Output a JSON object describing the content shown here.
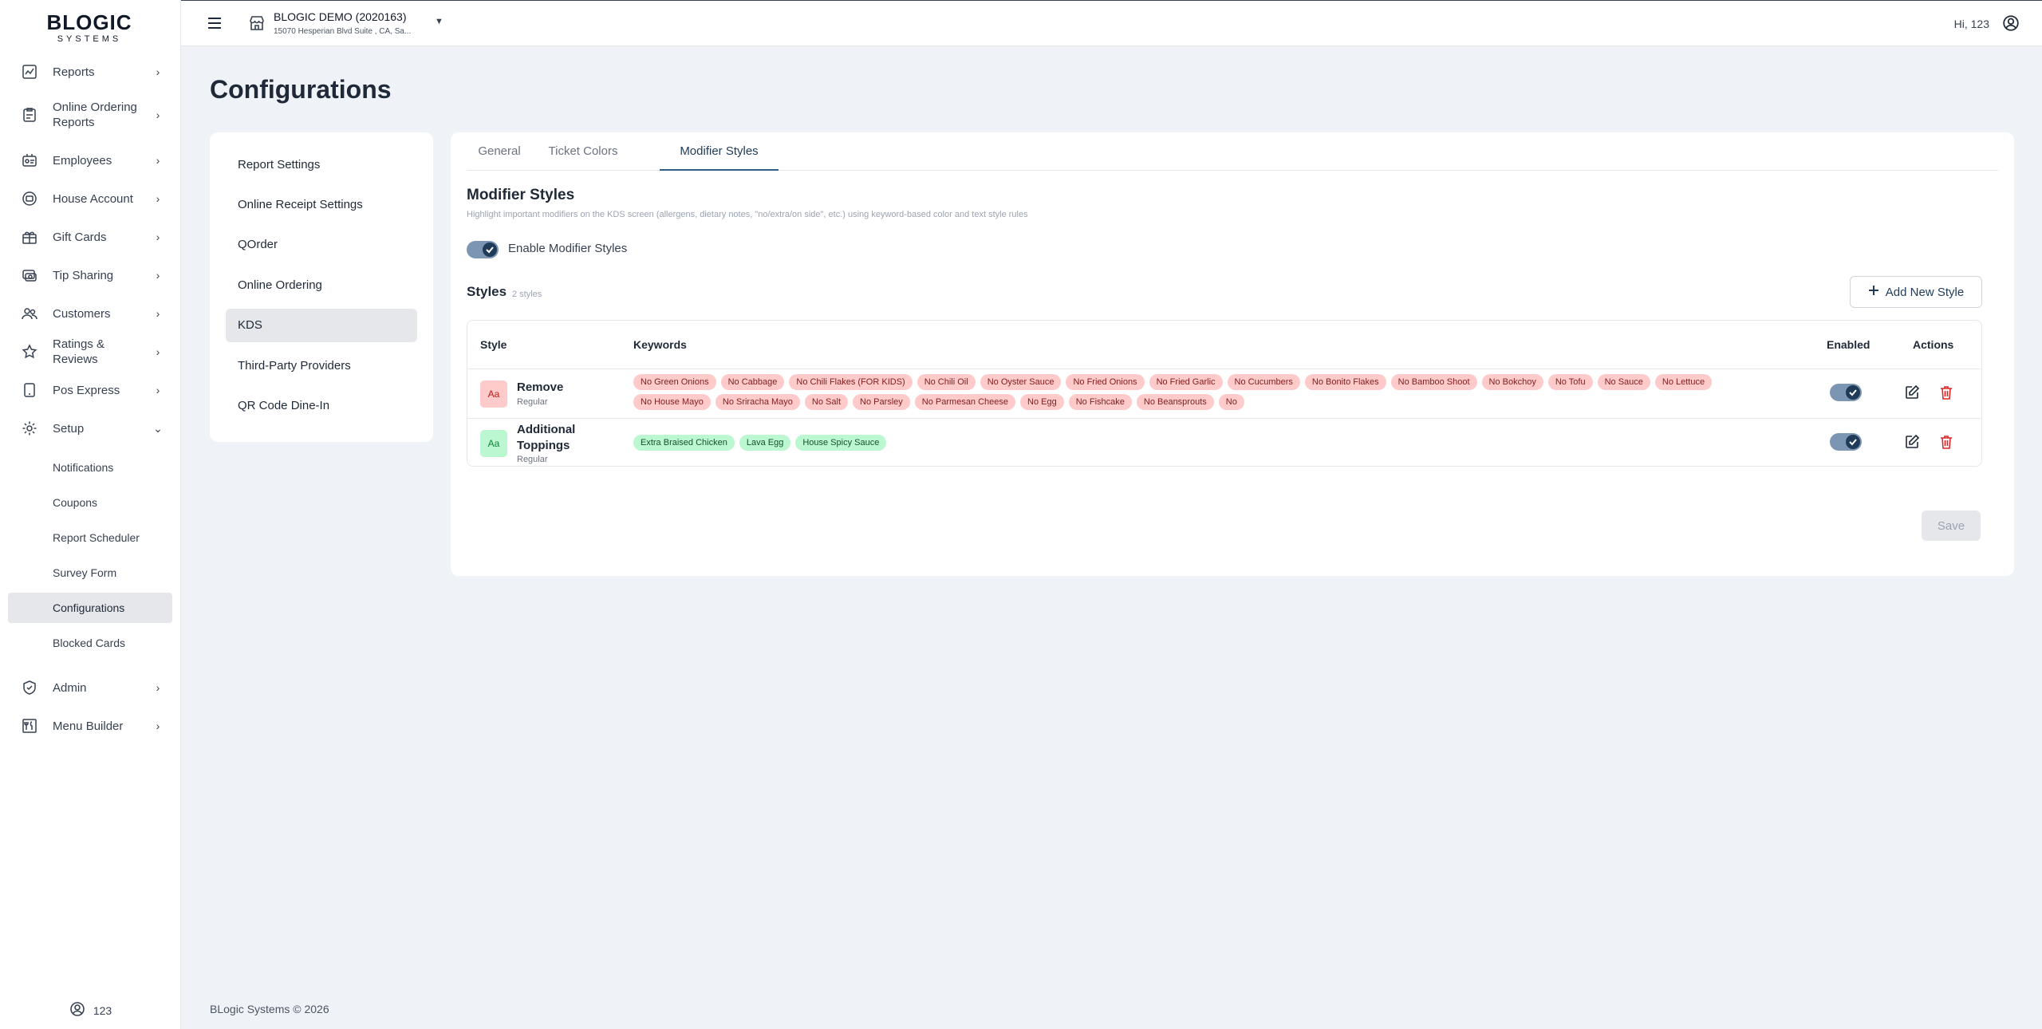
{
  "brand": {
    "name": "BLOGIC",
    "tagline": "SYSTEMS"
  },
  "sidebar": {
    "items": [
      {
        "label": "Reports",
        "icon": "chart-line-icon"
      },
      {
        "label": "Online Ordering Reports",
        "icon": "clipboard-report-icon"
      },
      {
        "label": "Employees",
        "icon": "id-badge-icon"
      },
      {
        "label": "House Account",
        "icon": "credit-circle-icon"
      },
      {
        "label": "Gift Cards",
        "icon": "gift-icon"
      },
      {
        "label": "Tip Sharing",
        "icon": "tip-sharing-icon"
      },
      {
        "label": "Customers",
        "icon": "users-icon"
      },
      {
        "label": "Ratings & Reviews",
        "icon": "star-icon"
      },
      {
        "label": "Pos Express",
        "icon": "device-icon"
      },
      {
        "label": "Setup",
        "icon": "gear-icon"
      }
    ],
    "setup_sub": [
      "Notifications",
      "Coupons",
      "Report Scheduler",
      "Survey Form",
      "Configurations",
      "Blocked Cards"
    ],
    "bottom_items": [
      {
        "label": "Admin",
        "icon": "shield-icon"
      },
      {
        "label": "Menu Builder",
        "icon": "menu-builder-icon"
      }
    ],
    "user": "123"
  },
  "topbar": {
    "store_name": "BLOGIC DEMO (2020163)",
    "store_address": "15070 Hesperian Blvd Suite , CA, Sa...",
    "greeting": "Hi, 123"
  },
  "page": {
    "title": "Configurations"
  },
  "config_menu": [
    "Report Settings",
    "Online Receipt Settings",
    "QOrder",
    "Online Ordering",
    "KDS",
    "Third-Party Providers",
    "QR Code Dine-In"
  ],
  "tabs": [
    "General",
    "Ticket Colors",
    "Modifier Styles"
  ],
  "modifier": {
    "title": "Modifier Styles",
    "description": "Highlight important modifiers on the KDS screen (allergens, dietary notes, \"no/extra/on side\", etc.) using keyword-based color and text style rules",
    "enable_label": "Enable Modifier Styles",
    "enabled": true,
    "styles_title": "Styles",
    "styles_count": "2 styles",
    "add_label": "Add New Style",
    "save_label": "Save"
  },
  "table": {
    "headers": {
      "style": "Style",
      "keywords": "Keywords",
      "enabled": "Enabled",
      "actions": "Actions"
    },
    "rows": [
      {
        "badge": "Aa",
        "name": "Remove",
        "sub": "Regular",
        "color": "#fecaca",
        "enabled": true,
        "keywords": [
          "No Green Onions",
          "No Cabbage",
          "No Chili Flakes (FOR KIDS)",
          "No Chili Oil",
          "No Oyster Sauce",
          "No Fried Onions",
          "No Fried Garlic",
          "No Cucumbers",
          "No Bonito Flakes",
          "No Bamboo Shoot",
          "No Bokchoy",
          "No Tofu",
          "No Sauce",
          "No Lettuce",
          "No House Mayo",
          "No Sriracha Mayo",
          "No Salt",
          "No Parsley",
          "No Parmesan Cheese",
          "No Egg",
          "No Fishcake",
          "No Beansprouts",
          "No"
        ]
      },
      {
        "badge": "Aa",
        "name": "Additional Toppings",
        "sub": "Regular",
        "color": "#bbf7d0",
        "enabled": true,
        "keywords": [
          "Extra Braised Chicken",
          "Lava Egg",
          "House Spicy Sauce"
        ]
      }
    ]
  },
  "footer": "BLogic Systems © 2026"
}
